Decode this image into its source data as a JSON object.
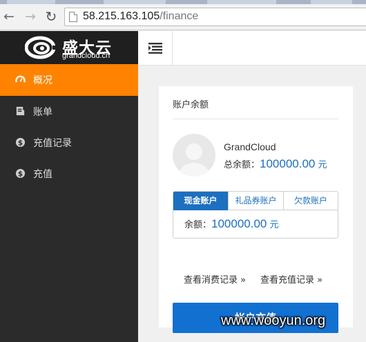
{
  "browser": {
    "url_host": "58.215.163.105",
    "url_path": "/finance",
    "back_icon": "arrow-left-icon",
    "forward_icon": "arrow-right-icon",
    "reload_icon": "reload-icon"
  },
  "brand": {
    "name": "盛大云",
    "domain": "grandcloud.cn",
    "color": "#ffffff"
  },
  "sidebar": {
    "items": [
      {
        "label": "概况",
        "icon": "dashboard-gauge-icon",
        "active": true
      },
      {
        "label": "账单",
        "icon": "bill-icon",
        "active": false
      },
      {
        "label": "充值记录",
        "icon": "dollar-icon",
        "active": false
      },
      {
        "label": "充值",
        "icon": "dollar-icon",
        "active": false
      }
    ],
    "active_color": "#ff8200",
    "background": "#2b2b2b"
  },
  "topbar": {
    "collapse_icon": "collapse-menu-icon"
  },
  "balance_card": {
    "title": "账户余额",
    "user_name": "GrandCloud",
    "total_label": "总余额：",
    "total_amount": "100000.00",
    "total_unit": "元",
    "tabs": [
      "现金账户",
      "礼品券账户",
      "欠款账户"
    ],
    "active_tab": 0,
    "balance_label": "余额：",
    "balance_amount": "100000.00",
    "balance_unit": "元",
    "link_consumption": "查看消费记录 »",
    "link_recharge": "查看充值记录 »",
    "recharge_button": "帐户充值",
    "accent_color": "#1170d0"
  },
  "watermark": "www.wooyun.org"
}
